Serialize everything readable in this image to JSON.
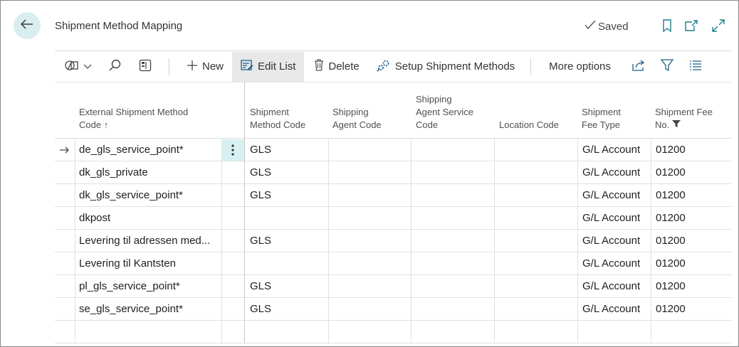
{
  "header": {
    "title": "Shipment Method Mapping",
    "saved_label": "Saved"
  },
  "actionbar": {
    "new_label": "New",
    "edit_list_label": "Edit List",
    "delete_label": "Delete",
    "setup_label": "Setup Shipment Methods",
    "more_label": "More options"
  },
  "columns": {
    "external_line1": "External Shipment Method",
    "external_line2": "Code",
    "sort_indicator": "↑",
    "method_line1": "Shipment",
    "method_line2": "Method Code",
    "agent_line1": "Shipping",
    "agent_line2": "Agent Code",
    "service_line1": "Shipping",
    "service_line2": "Agent Service",
    "service_line3": "Code",
    "location": "Location Code",
    "feetype_line1": "Shipment",
    "feetype_line2": "Fee Type",
    "feeno_line1": "Shipment Fee",
    "feeno_line2": "No."
  },
  "rows": [
    {
      "external": "de_gls_service_point*",
      "method": "GLS",
      "agent": "",
      "service": "",
      "location": "",
      "fee_type": "G/L Account",
      "fee_no": "01200"
    },
    {
      "external": "dk_gls_private",
      "method": "GLS",
      "agent": "",
      "service": "",
      "location": "",
      "fee_type": "G/L Account",
      "fee_no": "01200"
    },
    {
      "external": "dk_gls_service_point*",
      "method": "GLS",
      "agent": "",
      "service": "",
      "location": "",
      "fee_type": "G/L Account",
      "fee_no": "01200"
    },
    {
      "external": "dkpost",
      "method": "",
      "agent": "",
      "service": "",
      "location": "",
      "fee_type": "G/L Account",
      "fee_no": "01200"
    },
    {
      "external": "Levering til adressen med...",
      "method": "GLS",
      "agent": "",
      "service": "",
      "location": "",
      "fee_type": "G/L Account",
      "fee_no": "01200"
    },
    {
      "external": "Levering til Kantsten",
      "method": "",
      "agent": "",
      "service": "",
      "location": "",
      "fee_type": "G/L Account",
      "fee_no": "01200"
    },
    {
      "external": "pl_gls_service_point*",
      "method": "GLS",
      "agent": "",
      "service": "",
      "location": "",
      "fee_type": "G/L Account",
      "fee_no": "01200"
    },
    {
      "external": "se_gls_service_point*",
      "method": "GLS",
      "agent": "",
      "service": "",
      "location": "",
      "fee_type": "G/L Account",
      "fee_no": "01200"
    }
  ],
  "icons": {
    "back": "back-arrow-icon",
    "saved": "checkmark-icon",
    "bookmark": "bookmark-icon",
    "open_new": "open-in-new-window-icon",
    "expand": "expand-icon",
    "views": "views-icon",
    "search": "search-icon",
    "filter_pane": "filter-pane-icon",
    "new": "plus-icon",
    "edit_list": "edit-list-icon",
    "delete": "trash-icon",
    "setup": "setup-icon",
    "share": "share-icon",
    "filter": "filter-icon",
    "list": "list-icon",
    "row_selected": "right-arrow-icon",
    "row_menu": "more-vertical-icon"
  },
  "colors": {
    "accent": "#d9eef0",
    "selected_cell": "#d7f0f2"
  }
}
